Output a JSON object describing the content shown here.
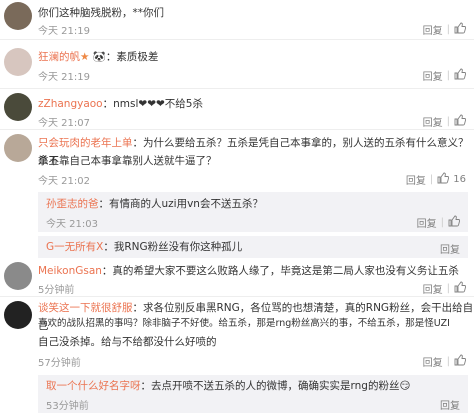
{
  "comments": [
    {
      "text": "你们这种脑残脱粉，**你们",
      "time": "今天 21:19",
      "reply": "回复"
    },
    {
      "user": "狂澜的帆",
      "text": "：素质极差",
      "time": "今天 21:19",
      "reply": "回复"
    },
    {
      "user": "zZhangyaoo",
      "text": "：nmsl❤❤❤不给5杀",
      "time": "今天 21:07",
      "reply": "回复"
    },
    {
      "user": "只会玩肉的老年上单",
      "text_l1": "：为什么要给五杀？五杀是凭自己本事拿的，别人送的五杀有什么意义？拿五",
      "text_l2": "杀不靠自己本事拿靠别人送就牛逼了？",
      "time": "今天 21:02",
      "reply": "回复",
      "likes": "16"
    },
    {
      "user": "MeikonGsan",
      "text": "：真的希望大家不要这么败路人缘了，毕竟这是第二局人家也没有义务让五杀",
      "time": "5分钟前",
      "reply": "回复"
    },
    {
      "user": "谈笑这一下就很舒服",
      "text_l1": "：求各位别反串黑RNG，各位骂的也想清楚，真的RNG粉丝，会干出给自己",
      "text_l2": "喜欢的战队招黑的事吗？除非脑子不好使。给五杀，那是rng粉丝高兴的事，不给五杀，那是怪UZI",
      "text_l3": "自己没杀掉。给与不给都没什么好喷的",
      "time": "57分钟前",
      "reply": "回复"
    }
  ],
  "sub_replies": [
    {
      "user": "孙歪志的爸",
      "text": "：有情商的人uzi用vn会不送五杀？",
      "time": "今天 21:03",
      "reply": "回复"
    },
    {
      "user": "G一无所有X",
      "text": "：我RNG粉丝没有你这种孤儿",
      "reply": "回复"
    },
    {
      "user": "取一个什么好名字呀",
      "text": "：去点开喷不送五杀的人的微博，确确实实是rng的粉丝",
      "time": "53分钟前",
      "reply": "回复"
    }
  ]
}
